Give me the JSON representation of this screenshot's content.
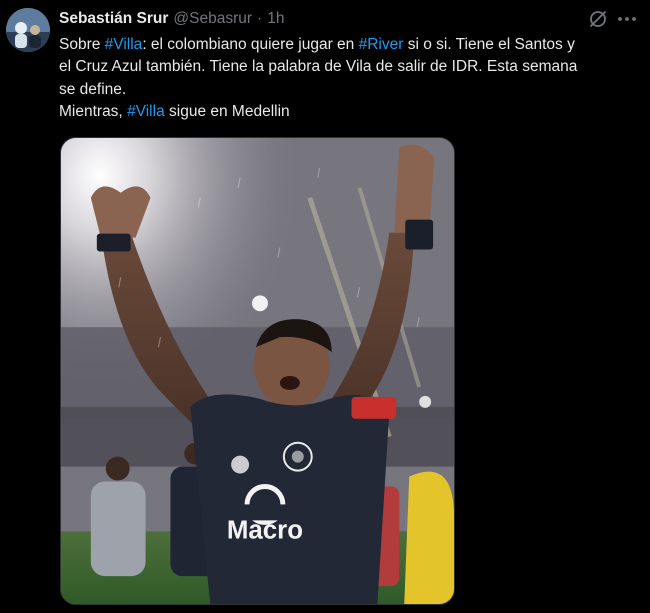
{
  "author": {
    "display_name": "Sebastián Srur",
    "handle": "@Sebasrur",
    "separator": "·",
    "time": "1h"
  },
  "tweet": {
    "line1_a": "Sobre ",
    "hashtag_villa": "#Villa",
    "line1_b": ": el colombiano quiere jugar en ",
    "hashtag_river": "#River",
    "line1_c": " si o si. Tiene el Santos y",
    "line2": "el Cruz Azul también.  Tiene la palabra de Vila de salir de IDR. Esta semana",
    "line3": "se define.",
    "line4_a": "Mientras, ",
    "line4_hashtag": "#Villa",
    "line4_b": " sigue en Medellin"
  },
  "media": {
    "jersey_sponsor": "Macro"
  },
  "icons": {
    "grok": "grok-icon",
    "more": "more-icon"
  },
  "colors": {
    "background": "#000000",
    "text": "#e7e9ea",
    "secondary": "#71767b",
    "link": "#1d9bf0"
  }
}
